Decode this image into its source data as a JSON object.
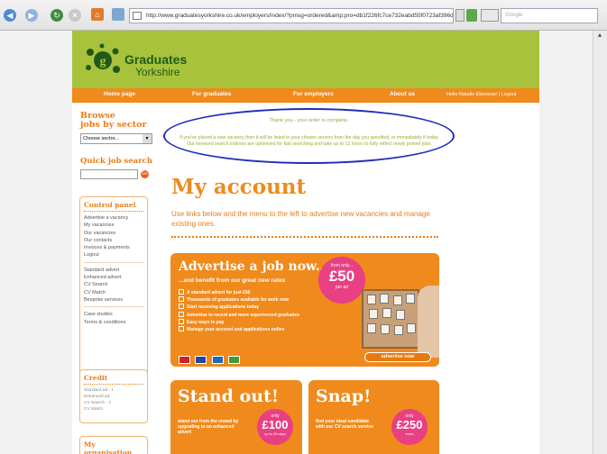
{
  "browser": {
    "url": "http://www.graduatesyorkshire.co.uk/employers/index/?pmsg=ordered&amp;pro=db1f226fc7ce732eabd55f0723af396d",
    "search_placeholder": "Google"
  },
  "site": {
    "logo_line1": "Graduates",
    "logo_line2": "Yorkshire",
    "nav": {
      "home": "Home page",
      "graduates": "For graduates",
      "employers": "For employers",
      "about": "About us",
      "hello": "Hello Natalie Ebenezer | Logout"
    },
    "sidebar": {
      "browse_title_1": "Browse",
      "browse_title_2": "jobs by sector",
      "sector_value": "Choose sector...",
      "quick_search_title": "Quick job search",
      "quick_search_go": "Go",
      "control_panel": {
        "title": "Control panel",
        "group1": [
          "Advertise a vacancy",
          "My vacancies",
          "Our vacancies",
          "Our contacts",
          "Invoices & payments",
          "Logout"
        ],
        "group2": [
          "Standard advert",
          "Enhanced advert",
          "CV Search",
          "CV Match",
          "Bespoke services"
        ],
        "group3": [
          "Case studies",
          "Terms & conditions"
        ]
      },
      "credit": {
        "title": "Credit",
        "items": [
          "Standard ad - 1",
          "Enhanced ad",
          "CV Search - 1",
          "CV Match"
        ]
      },
      "my_organisation_title": "My organisation"
    },
    "notice": {
      "line1": "Thank you - your order is complete.",
      "line2": "If you've placed a new vacancy then it will be listed in your chosen sectors from the day you specified, or immediately if today. Our keyword search indexes are optimised for fast searching and take up to 12 hours to fully reflect newly posted jobs."
    },
    "main": {
      "title": "My account",
      "intro": "Use links below and the menu to the left to advertise new vacancies and manage existing ones.",
      "advert": {
        "title": "Advertise a job now...",
        "subtitle": "...and benefit from our great new rates",
        "bullets": [
          "A standard advert for just £50",
          "Thousands of graduates available for work now",
          "Start receiving applications today",
          "Advertise to recent and more experienced graduates",
          "Easy ways to pay",
          "Manage your account and applications online"
        ],
        "badge_from": "from only...",
        "badge_price": "£50",
        "badge_per": "per ad",
        "cta": "advertise now",
        "cards": [
          "Mastercard",
          "VISA",
          "Electron",
          "Maestro"
        ]
      },
      "standout": {
        "title": "Stand out!",
        "text": "stand out from the crowd by upgrading to an enhanced advert",
        "badge_top": "only",
        "badge_price": "£100",
        "badge_bottom": "up to 28 days"
      },
      "snap": {
        "title": "Snap!",
        "text": "find your ideal candidate with our CV search service",
        "badge_top": "only",
        "badge_price": "£250",
        "badge_bottom": "extra"
      }
    }
  }
}
